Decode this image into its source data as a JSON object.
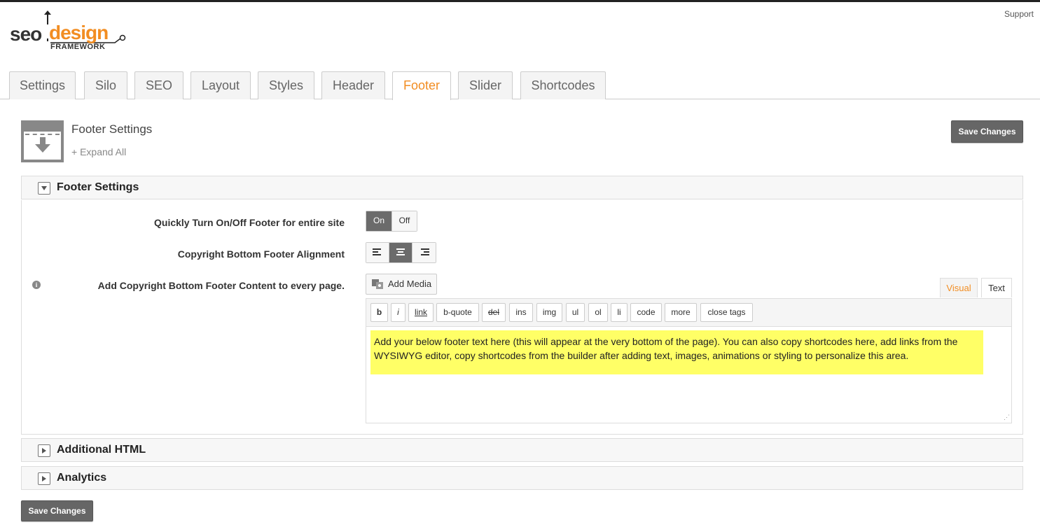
{
  "top": {
    "support_label": "Support"
  },
  "logo": {
    "seo": "seo",
    "design": "design",
    "framework": "FRAMEWORK"
  },
  "tabs": [
    {
      "label": "Settings"
    },
    {
      "label": "Silo"
    },
    {
      "label": "SEO"
    },
    {
      "label": "Layout"
    },
    {
      "label": "Styles"
    },
    {
      "label": "Header"
    },
    {
      "label": "Footer"
    },
    {
      "label": "Slider"
    },
    {
      "label": "Shortcodes"
    }
  ],
  "active_tab": "Footer",
  "page": {
    "title": "Footer Settings",
    "expand_all": "+ Expand All",
    "save_label": "Save Changes"
  },
  "panels": {
    "footer": {
      "title": "Footer Settings",
      "rows": {
        "toggle_label": "Quickly Turn On/Off Footer for entire site",
        "toggle_on": "On",
        "toggle_off": "Off",
        "toggle_value": "On",
        "align_label": "Copyright Bottom Footer Alignment",
        "align_value": "center",
        "content_label": "Add Copyright Bottom Footer Content to every page."
      },
      "editor": {
        "add_media": "Add Media",
        "tab_visual": "Visual",
        "tab_text": "Text",
        "quicktags": [
          "b",
          "i",
          "link",
          "b-quote",
          "del",
          "ins",
          "img",
          "ul",
          "ol",
          "li",
          "code",
          "more",
          "close tags"
        ],
        "content": "Add your below footer text here (this will appear at the very bottom of the page). You can also copy shortcodes here, add links from the WYSIWYG editor, copy shortcodes from the builder after adding text, images, animations or styling to personalize this area."
      }
    },
    "additional_html": {
      "title": "Additional HTML"
    },
    "analytics": {
      "title": "Analytics"
    }
  },
  "bottom": {
    "save_label": "Save Changes"
  },
  "colors": {
    "accent": "#f28d22",
    "button": "#666666",
    "highlight": "#ffff66"
  }
}
